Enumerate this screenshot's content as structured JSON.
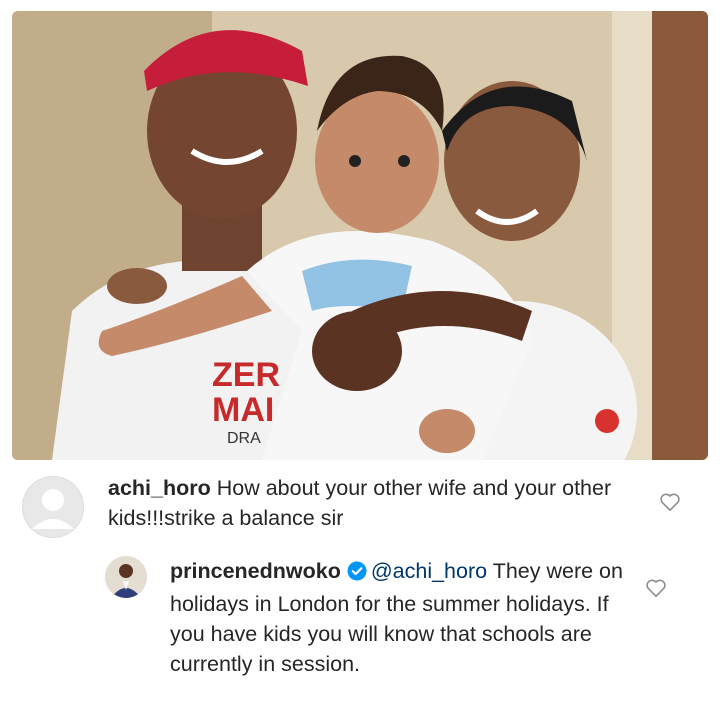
{
  "post": {
    "image": {
      "description_icon": "family-photo",
      "shirt_text_lines": [
        "ZER",
        "MAI",
        "DRA"
      ]
    }
  },
  "comments": [
    {
      "username": "achi_horo",
      "avatar_icon": "default-user-avatar-icon",
      "text": "How about your other wife and your other kids!!!strike a balance sir",
      "verified": false,
      "liked": false
    },
    {
      "username": "princenednwoko",
      "avatar_icon": "profile-photo-avatar",
      "mention": "@achi_horo",
      "text": "They were on holidays in London for the summer holidays. If you have kids you will know that schools are currently in session.",
      "verified": true,
      "liked": false
    }
  ],
  "colors": {
    "text": "#262626",
    "mention": "#00376b",
    "verified_badge": "#0095f6",
    "heart_outline": "#8e8e8e"
  }
}
